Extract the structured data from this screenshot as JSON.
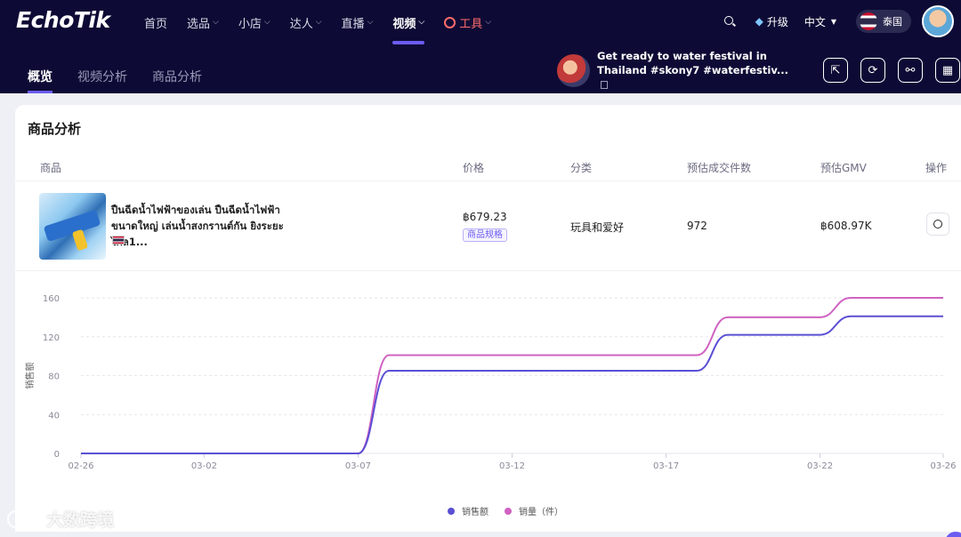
{
  "app": {
    "logo": "EchoTik"
  },
  "nav": {
    "items": [
      {
        "label": "首页",
        "has_menu": false
      },
      {
        "label": "选品",
        "has_menu": true
      },
      {
        "label": "小店",
        "has_menu": true
      },
      {
        "label": "达人",
        "has_menu": true
      },
      {
        "label": "直播",
        "has_menu": true
      },
      {
        "label": "视频",
        "has_menu": true,
        "active": true
      },
      {
        "label": "工具",
        "has_menu": true
      }
    ],
    "upgrade": "升级",
    "language": "中文",
    "country": "泰国"
  },
  "subtabs": [
    "概览",
    "视频分析",
    "商品分析"
  ],
  "video": {
    "title": "Get ready to water festival in Thailand #skony7 #waterfestiv..."
  },
  "section": {
    "title": "商品分析"
  },
  "table": {
    "headers": [
      "商品",
      "价格",
      "分类",
      "预估成交件数",
      "预估GMV",
      "操作"
    ],
    "row": {
      "name": "ปืนฉีดน้ำไฟฟ้าของเล่น ปืนฉีดน้ำไฟฟ้าขนาดใหญ่ เล่นน้ำสงกรานต์กัน ยิงระยะไกล1...",
      "price": "฿679.23",
      "spec": "商品规格",
      "category": "玩具和爱好",
      "quantity": "972",
      "gmv": "฿608.97K"
    }
  },
  "chart_data": {
    "type": "line",
    "ylabel": "销售额",
    "ylim": [
      0,
      160
    ],
    "yticks": [
      0,
      40,
      80,
      120,
      160
    ],
    "xticks": [
      "02-26",
      "03-02",
      "03-07",
      "03-12",
      "03-17",
      "03-22",
      "03-26"
    ],
    "x": [
      "02-26",
      "02-27",
      "02-28",
      "03-01",
      "03-02",
      "03-03",
      "03-04",
      "03-05",
      "03-06",
      "03-07",
      "03-08",
      "03-09",
      "03-10",
      "03-11",
      "03-12",
      "03-13",
      "03-14",
      "03-15",
      "03-16",
      "03-17",
      "03-18",
      "03-19",
      "03-20",
      "03-21",
      "03-22",
      "03-23",
      "03-24",
      "03-25",
      "03-26"
    ],
    "series": [
      {
        "name": "销售额",
        "color": "#5b4fd4",
        "values": [
          0,
          0,
          0,
          0,
          0,
          0,
          0,
          0,
          0,
          0,
          85,
          85,
          85,
          85,
          85,
          85,
          85,
          85,
          85,
          85,
          85,
          122,
          122,
          122,
          122,
          141,
          141,
          141,
          141
        ]
      },
      {
        "name": "销量（件）",
        "color": "#d062c2",
        "values": [
          0,
          0,
          0,
          0,
          0,
          0,
          0,
          0,
          0,
          0,
          101,
          101,
          101,
          101,
          101,
          101,
          101,
          101,
          101,
          101,
          101,
          140,
          140,
          140,
          140,
          160,
          160,
          160,
          160
        ]
      }
    ],
    "grid": true,
    "legend": "bottom"
  },
  "watermark": "大数跨境"
}
